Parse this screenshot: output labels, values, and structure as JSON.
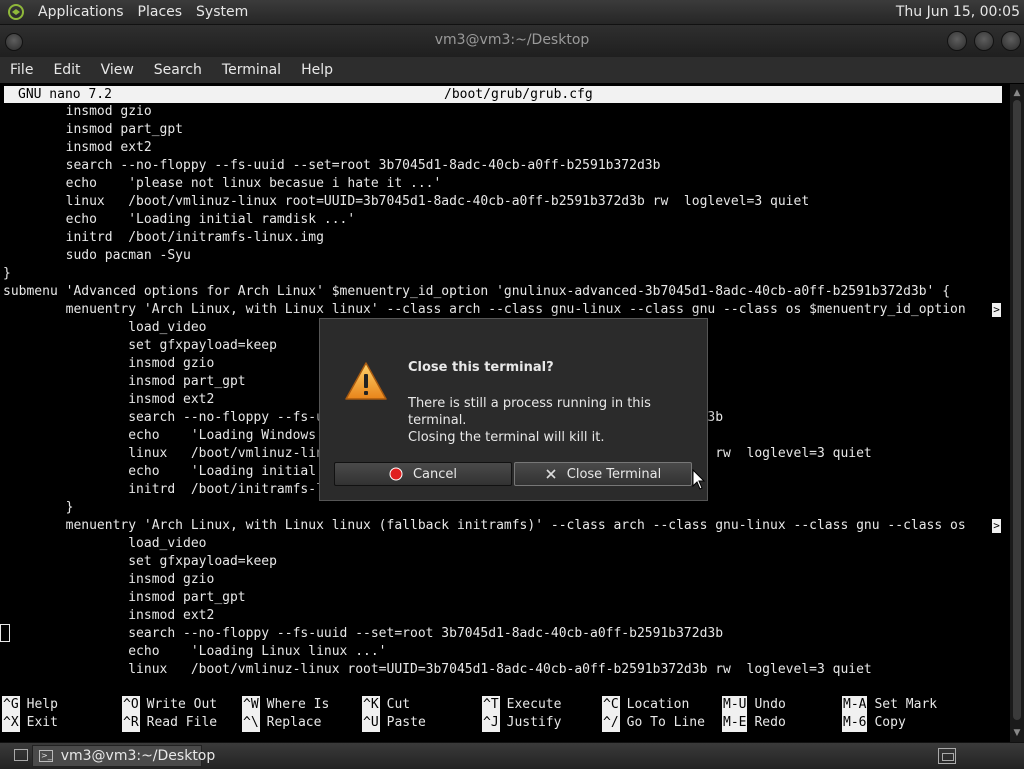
{
  "top_panel": {
    "menus": [
      "Applications",
      "Places",
      "System"
    ],
    "clock": "Thu Jun 15, 00:05"
  },
  "window": {
    "title": "vm3@vm3:~/Desktop"
  },
  "menubar": {
    "items": [
      "File",
      "Edit",
      "View",
      "Search",
      "Terminal",
      "Help"
    ]
  },
  "nano": {
    "version": "GNU nano 7.2",
    "filename": "/boot/grub/grub.cfg",
    "lines": [
      "        insmod gzio",
      "        insmod part_gpt",
      "        insmod ext2",
      "        search --no-floppy --fs-uuid --set=root 3b7045d1-8adc-40cb-a0ff-b2591b372d3b",
      "        echo    'please not linux becasue i hate it ...'",
      "        linux   /boot/vmlinuz-linux root=UUID=3b7045d1-8adc-40cb-a0ff-b2591b372d3b rw  loglevel=3 quiet",
      "        echo    'Loading initial ramdisk ...'",
      "        initrd  /boot/initramfs-linux.img",
      "        sudo pacman -Syu",
      "}",
      "submenu 'Advanced options for Arch Linux' $menuentry_id_option 'gnulinux-advanced-3b7045d1-8adc-40cb-a0ff-b2591b372d3b' {",
      "        menuentry 'Arch Linux, with Linux linux' --class arch --class gnu-linux --class gnu --class os $menuentry_id_option",
      "                load_video",
      "                set gfxpayload=keep",
      "                insmod gzio",
      "                insmod part_gpt",
      "                insmod ext2",
      "                search --no-floppy --fs-uuid --set=root 3b7045d1-8adc-40cb-a0ff-b2591b372d3b",
      "                echo    'Loading Windows 11 ...'",
      "                linux   /boot/vmlinuz-linux root=UUID=3b7045d1-8adc-40cb-a0ff-b2591b372d3b rw  loglevel=3 quiet",
      "                echo    'Loading initial ramdisk ...'",
      "                initrd  /boot/initramfs-linux.img",
      "        }",
      "        menuentry 'Arch Linux, with Linux linux (fallback initramfs)' --class arch --class gnu-linux --class gnu --class os",
      "                load_video",
      "                set gfxpayload=keep",
      "                insmod gzio",
      "                insmod part_gpt",
      "                insmod ext2",
      "                search --no-floppy --fs-uuid --set=root 3b7045d1-8adc-40cb-a0ff-b2591b372d3b",
      "                echo    'Loading Linux linux ...'",
      "                linux   /boot/vmlinuz-linux root=UUID=3b7045d1-8adc-40cb-a0ff-b2591b372d3b rw  loglevel=3 quiet"
    ],
    "overflow_marker": ">",
    "shortcuts": [
      {
        "key": "^G",
        "label": "Help"
      },
      {
        "key": "^O",
        "label": "Write Out"
      },
      {
        "key": "^W",
        "label": "Where Is"
      },
      {
        "key": "^K",
        "label": "Cut"
      },
      {
        "key": "^T",
        "label": "Execute"
      },
      {
        "key": "^C",
        "label": "Location"
      },
      {
        "key": "M-U",
        "label": "Undo"
      },
      {
        "key": "M-A",
        "label": "Set Mark"
      },
      {
        "key": "^X",
        "label": "Exit"
      },
      {
        "key": "^R",
        "label": "Read File"
      },
      {
        "key": "^\\",
        "label": "Replace"
      },
      {
        "key": "^U",
        "label": "Paste"
      },
      {
        "key": "^J",
        "label": "Justify"
      },
      {
        "key": "^/",
        "label": "Go To Line"
      },
      {
        "key": "M-E",
        "label": "Redo"
      },
      {
        "key": "M-6",
        "label": "Copy"
      }
    ]
  },
  "dialog": {
    "title": "Close this terminal?",
    "message_line1": "There is still a process running in this terminal.",
    "message_line2": "Closing the terminal will kill it.",
    "cancel_label": "Cancel",
    "close_label": "Close Terminal",
    "icon": "warning-icon"
  },
  "taskbar": {
    "window_button": "vm3@vm3:~/Desktop"
  },
  "colors": {
    "warning": "#f0a030",
    "cancel_icon": "#e02020"
  }
}
